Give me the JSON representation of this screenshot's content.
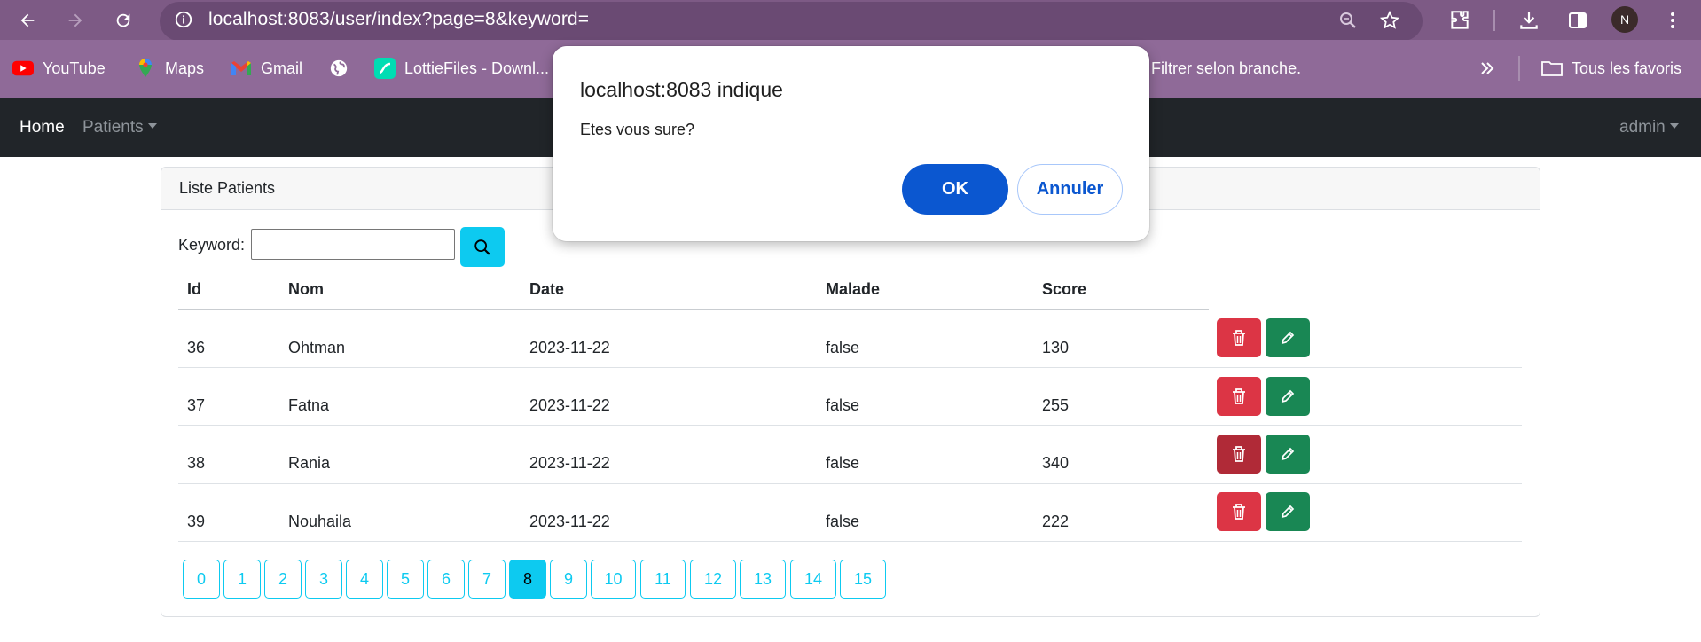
{
  "browser": {
    "url": "localhost:8083/user/index?page=8&keyword=",
    "avatar_letter": "N",
    "bookmarks": [
      {
        "label": "YouTube",
        "icon": "youtube-icon"
      },
      {
        "label": "Maps",
        "icon": "maps-icon"
      },
      {
        "label": "Gmail",
        "icon": "gmail-icon"
      },
      {
        "label": "",
        "icon": "globe-icon"
      },
      {
        "label": "LottieFiles - Downl...",
        "icon": "lottiefiles-icon"
      },
      {
        "label": "Filtrer selon branche.",
        "icon": ""
      },
      {
        "label": "Tous les favoris",
        "icon": "folder-icon"
      }
    ]
  },
  "navbar": {
    "home": "Home",
    "patients": "Patients",
    "user": "admin"
  },
  "card": {
    "title": "Liste Patients",
    "keyword_label": "Keyword:",
    "keyword_value": ""
  },
  "table": {
    "headers": [
      "Id",
      "Nom",
      "Date",
      "Malade",
      "Score"
    ],
    "rows": [
      {
        "id": "36",
        "nom": "Ohtman",
        "date": "2023-11-22",
        "malade": "false",
        "score": "130"
      },
      {
        "id": "37",
        "nom": "Fatna",
        "date": "2023-11-22",
        "malade": "false",
        "score": "255"
      },
      {
        "id": "38",
        "nom": "Rania",
        "date": "2023-11-22",
        "malade": "false",
        "score": "340"
      },
      {
        "id": "39",
        "nom": "Nouhaila",
        "date": "2023-11-22",
        "malade": "false",
        "score": "222"
      }
    ]
  },
  "pagination": {
    "pages": [
      "0",
      "1",
      "2",
      "3",
      "4",
      "5",
      "6",
      "7",
      "8",
      "9",
      "10",
      "11",
      "12",
      "13",
      "14",
      "15"
    ],
    "current": "8"
  },
  "dialog": {
    "title": "localhost:8083 indique",
    "message": "Etes vous sure?",
    "ok_label": "OK",
    "cancel_label": "Annuler"
  },
  "colors": {
    "danger": "#dc3545",
    "success": "#198754",
    "info": "#0dcaf0",
    "navbar": "#212529",
    "dialog_primary": "#0b57d0"
  }
}
